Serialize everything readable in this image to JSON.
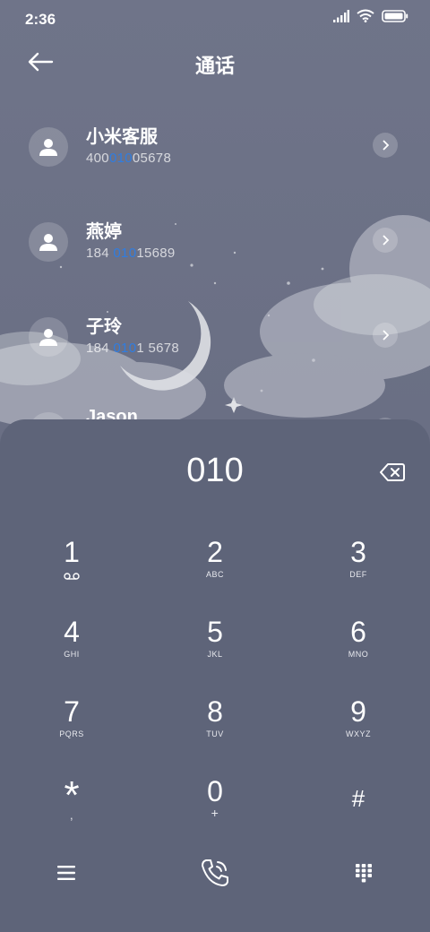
{
  "status_bar": {
    "time": "2:36",
    "icons": [
      "signal-icon",
      "wifi-icon",
      "battery-icon"
    ]
  },
  "header": {
    "title": "通话",
    "back_icon": "back-arrow-icon"
  },
  "contacts": [
    {
      "name": "小米客服",
      "number_pre": "400",
      "number_match": "010",
      "number_post": "05678"
    },
    {
      "name": "燕婷",
      "number_pre": "184 ",
      "number_match": "010",
      "number_post": "15689"
    },
    {
      "name": "子玲",
      "number_pre": "184 ",
      "number_match": "010",
      "number_post": "1 5678"
    },
    {
      "name": "Jason"
    }
  ],
  "dialer": {
    "input": "010",
    "backspace_icon": "backspace-icon",
    "keys": [
      {
        "digit": "1",
        "sub_icon": "voicemail-icon"
      },
      {
        "digit": "2",
        "sub": "ABC"
      },
      {
        "digit": "3",
        "sub": "DEF"
      },
      {
        "digit": "4",
        "sub": "GHI"
      },
      {
        "digit": "5",
        "sub": "JKL"
      },
      {
        "digit": "6",
        "sub": "MNO"
      },
      {
        "digit": "7",
        "sub": "PQRS"
      },
      {
        "digit": "8",
        "sub": "TUV"
      },
      {
        "digit": "9",
        "sub": "WXYZ"
      },
      {
        "digit": "*",
        "sub": ","
      },
      {
        "digit": "0",
        "sub": "+"
      },
      {
        "digit": "#",
        "sub": ""
      }
    ]
  },
  "bottom_bar": {
    "icons": [
      "menu-icon",
      "call-icon",
      "keypad-icon"
    ]
  },
  "colors": {
    "highlight": "#2f7de1",
    "panel": "#5e6479",
    "background": "#6a6f84"
  }
}
